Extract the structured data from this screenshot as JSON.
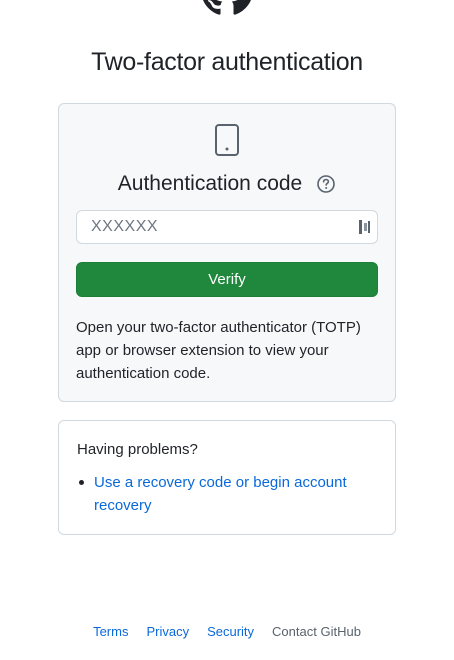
{
  "page": {
    "title": "Two-factor authentication"
  },
  "icons": {
    "logo": "github-logo-icon",
    "device": "mobile-device-icon",
    "help": "question-circle-icon",
    "password_manager": "password-manager-icon"
  },
  "auth": {
    "heading": "Authentication code",
    "input": {
      "value": "",
      "placeholder": "XXXXXX"
    },
    "verify_label": "Verify",
    "help_text": "Open your two-factor authenticator (TOTP) app or browser extension to view your authentication code."
  },
  "problems": {
    "title": "Having problems?",
    "items": [
      {
        "label": "Use a recovery code or begin account recovery"
      }
    ]
  },
  "footer": {
    "links": [
      {
        "label": "Terms"
      },
      {
        "label": "Privacy"
      },
      {
        "label": "Security"
      },
      {
        "label": "Contact GitHub"
      }
    ]
  },
  "colors": {
    "accent_green": "#1f883d",
    "link_blue": "#0969da",
    "box_background": "#f6f8fa",
    "border": "#d1d9e0"
  }
}
